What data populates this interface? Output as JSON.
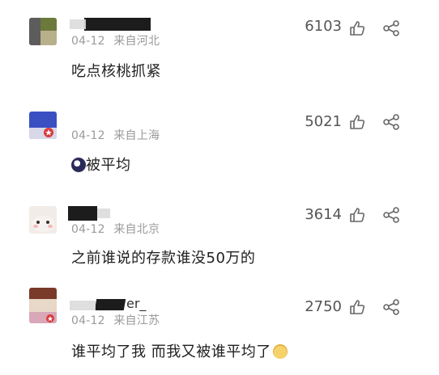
{
  "comments": [
    {
      "username": "",
      "date": "04-12",
      "location": "来自河北",
      "text": "吃点核桃抓紧",
      "likes": "6103"
    },
    {
      "username": "",
      "date": "04-12",
      "location": "来自上海",
      "text": "被平均",
      "likes": "5021"
    },
    {
      "username": "",
      "date": "04-12",
      "location": "来自北京",
      "text": "之前谁说的存款谁没50万的",
      "likes": "3614"
    },
    {
      "username": "er_",
      "date": "04-12",
      "location": "来自江苏",
      "text": "谁平均了我 而我又被谁平均了",
      "likes": "2750"
    }
  ],
  "icons": {
    "like": "thumbs-up-icon",
    "share": "share-icon"
  },
  "colors": {
    "meta": "#9a9a9a",
    "text": "#1f1f1f",
    "icon": "#666666"
  }
}
